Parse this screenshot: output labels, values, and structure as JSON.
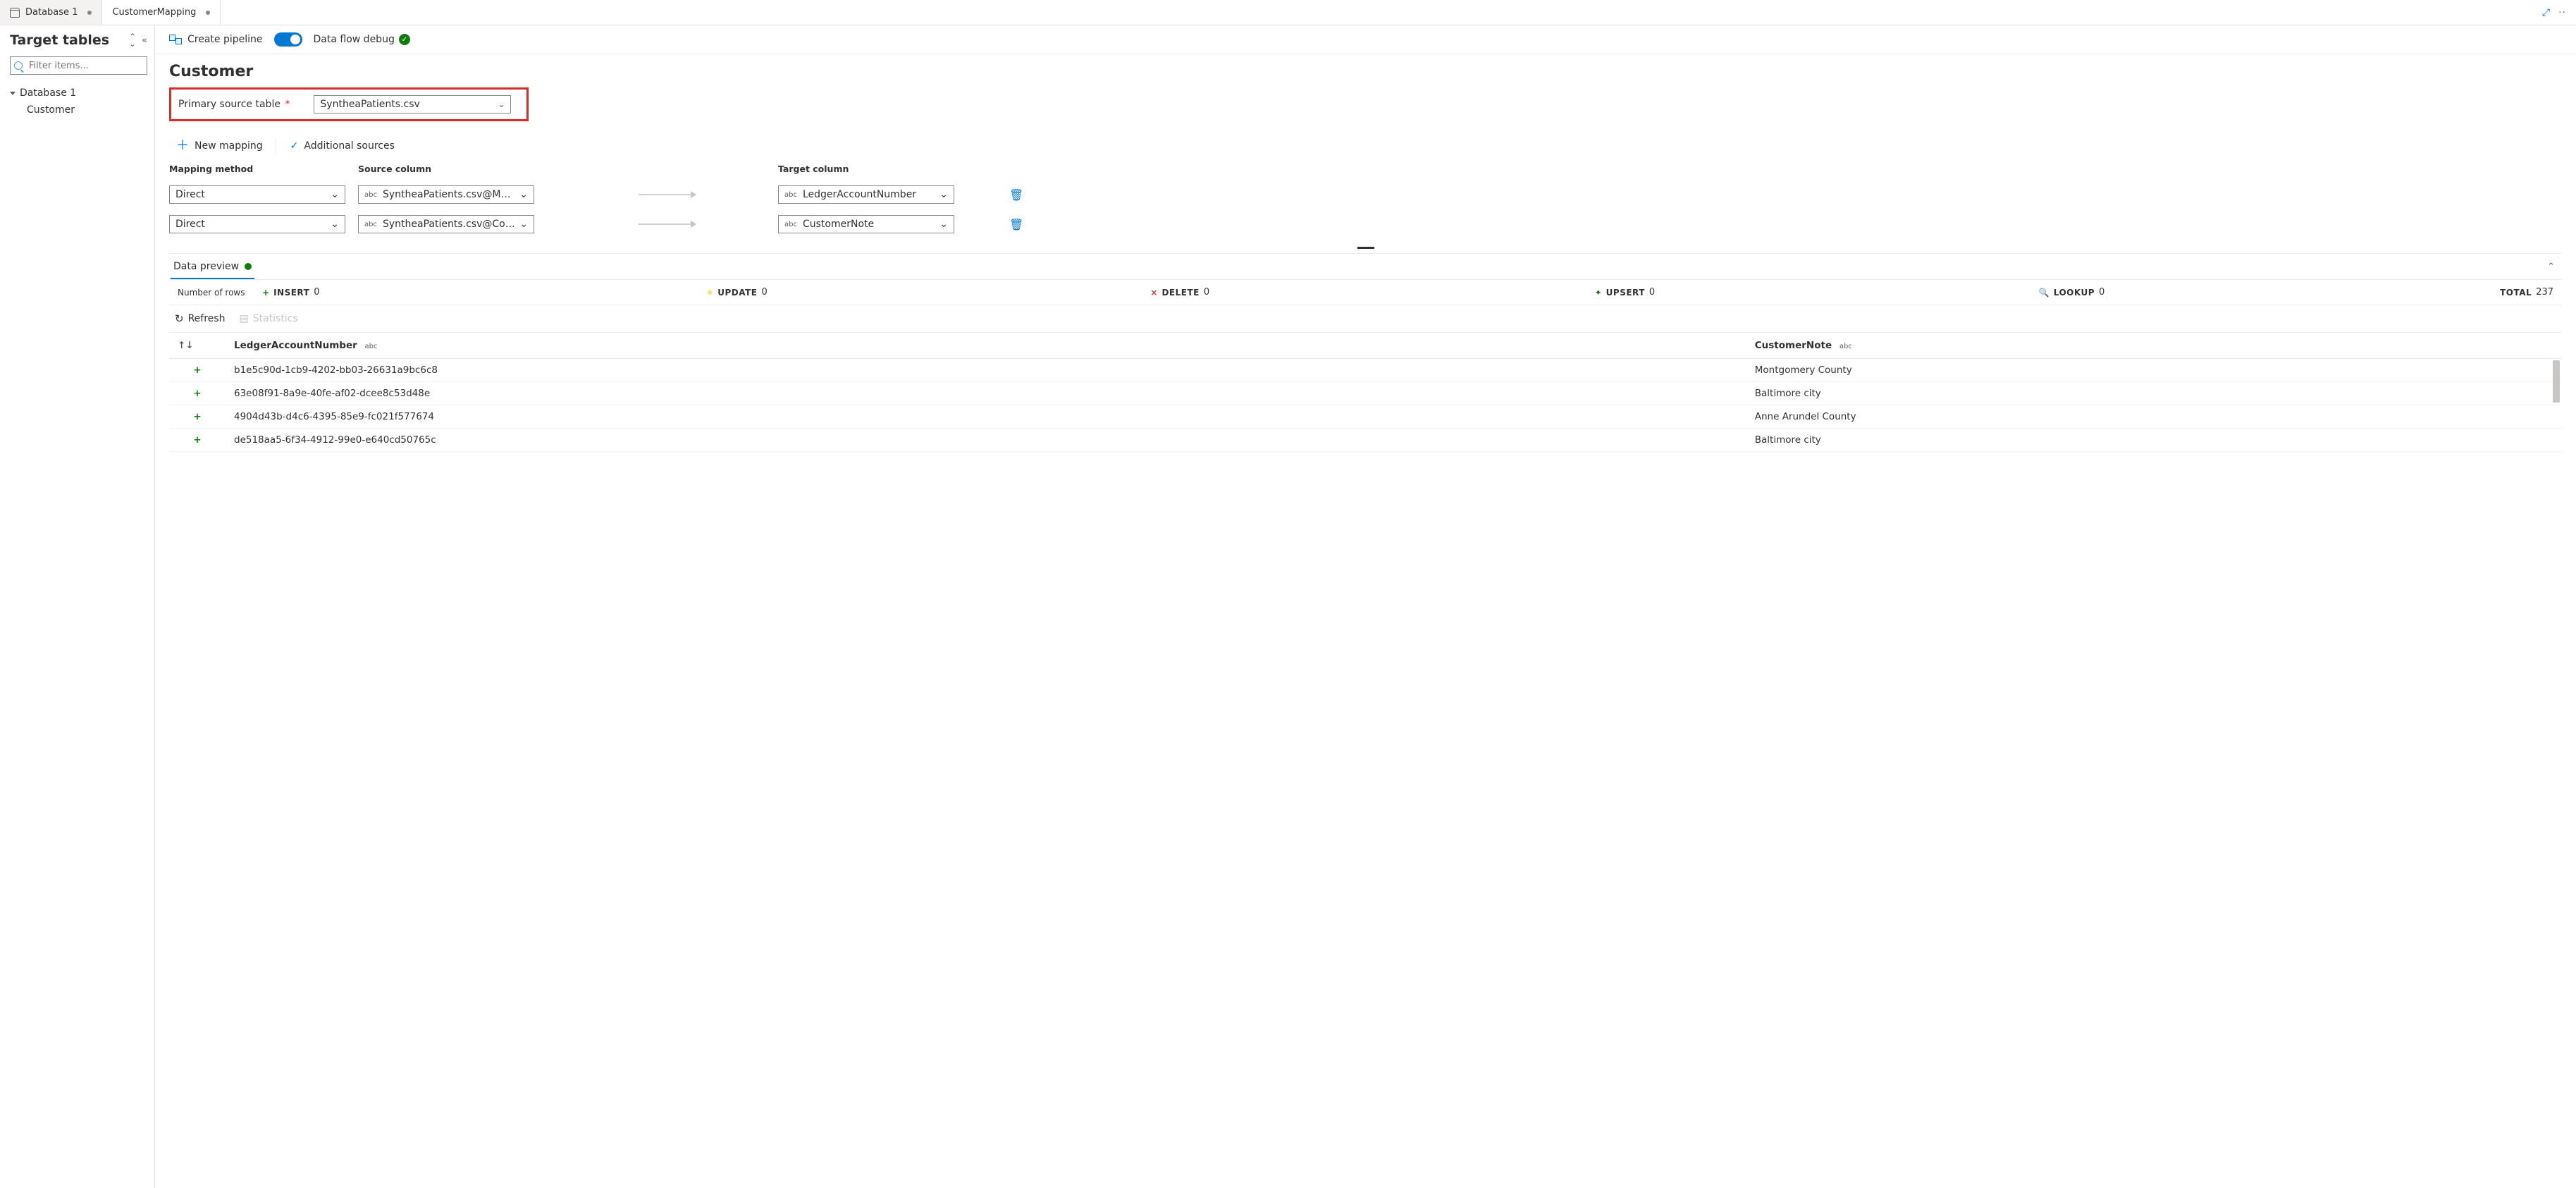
{
  "tabs": [
    {
      "label": "Database 1",
      "active": false,
      "dirty": true,
      "icon": "database"
    },
    {
      "label": "CustomerMapping",
      "active": true,
      "dirty": true,
      "icon": ""
    }
  ],
  "sidebar": {
    "title": "Target tables",
    "filter_placeholder": "Filter items...",
    "db": {
      "label": "Database 1"
    },
    "items": [
      {
        "label": "Customer"
      }
    ]
  },
  "toolbar": {
    "create_pipeline": "Create pipeline",
    "debug_label": "Data flow debug"
  },
  "entity": {
    "title": "Customer",
    "primary_source_label": "Primary source table",
    "primary_source_value": "SyntheaPatients.csv"
  },
  "mapping": {
    "new_mapping": "New mapping",
    "additional_sources": "Additional sources",
    "headers": {
      "method": "Mapping method",
      "source": "Source column",
      "target": "Target column"
    },
    "rows": [
      {
        "method": "Direct",
        "source": "SyntheaPatients.csv@Member id",
        "target": "LedgerAccountNumber"
      },
      {
        "method": "Direct",
        "source": "SyntheaPatients.csv@County",
        "target": "CustomerNote"
      }
    ]
  },
  "preview": {
    "tab_label": "Data preview",
    "rows_label": "Number of rows",
    "stats": {
      "insert": {
        "label": "INSERT",
        "value": "0"
      },
      "update": {
        "label": "UPDATE",
        "value": "0"
      },
      "delete": {
        "label": "DELETE",
        "value": "0"
      },
      "upsert": {
        "label": "UPSERT",
        "value": "0"
      },
      "lookup": {
        "label": "LOOKUP",
        "value": "0"
      },
      "total": {
        "label": "TOTAL",
        "value": "237"
      }
    },
    "refresh": "Refresh",
    "statistics": "Statistics",
    "columns": [
      {
        "label": "LedgerAccountNumber",
        "type": "abc"
      },
      {
        "label": "CustomerNote",
        "type": "abc"
      }
    ],
    "data_rows": [
      {
        "ledger": "b1e5c90d-1cb9-4202-bb03-26631a9bc6c8",
        "note": "Montgomery County"
      },
      {
        "ledger": "63e08f91-8a9e-40fe-af02-dcee8c53d48e",
        "note": "Baltimore city"
      },
      {
        "ledger": "4904d43b-d4c6-4395-85e9-fc021f577674",
        "note": "Anne Arundel County"
      },
      {
        "ledger": "de518aa5-6f34-4912-99e0-e640cd50765c",
        "note": "Baltimore city"
      }
    ]
  }
}
